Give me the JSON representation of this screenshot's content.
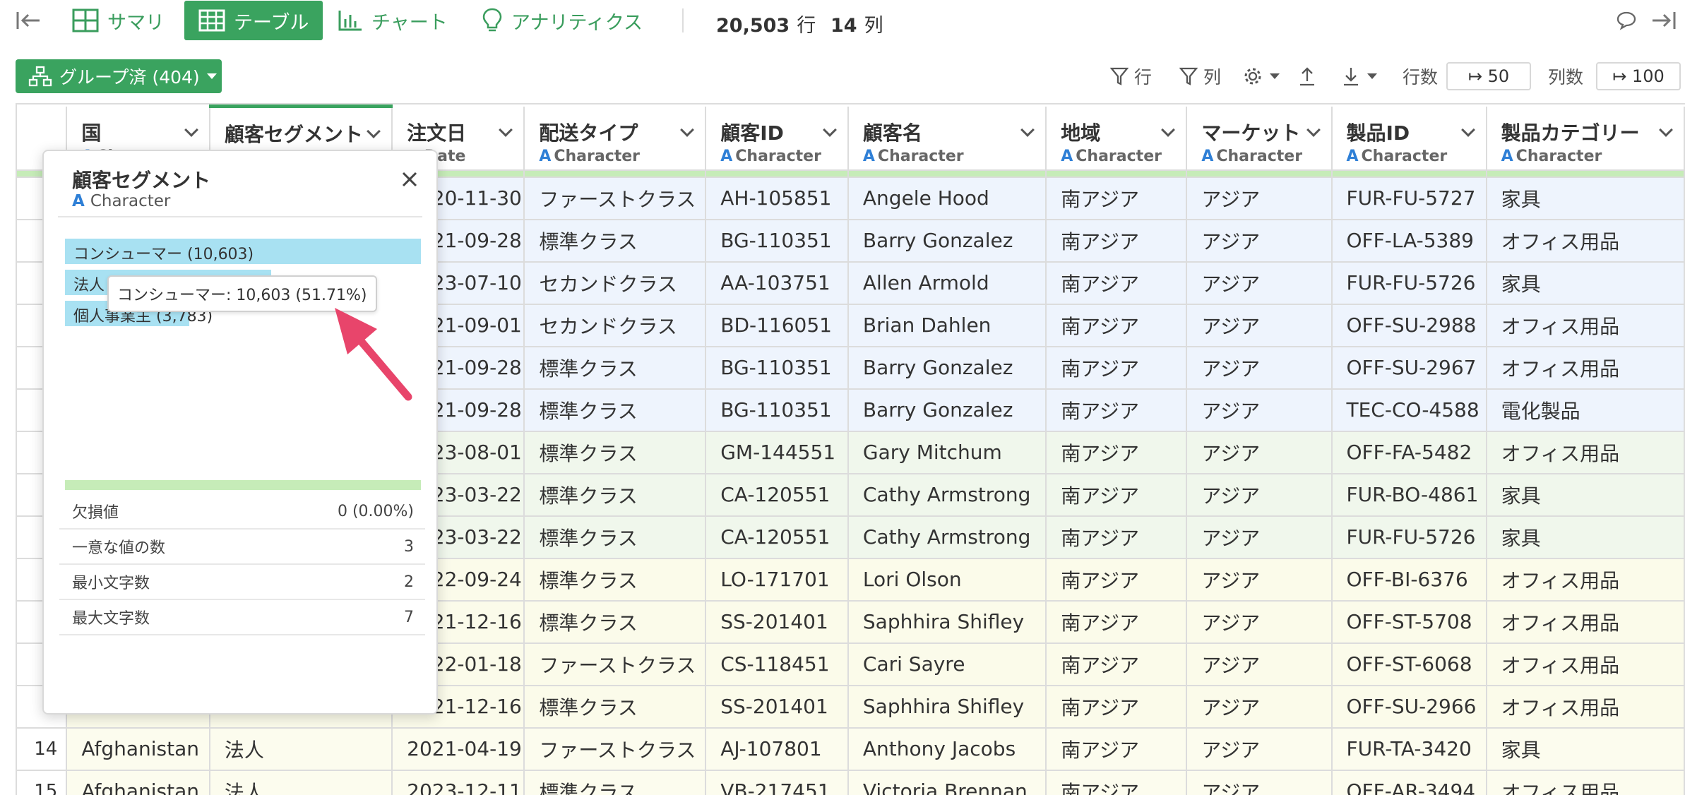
{
  "toolbar": {
    "tabs": [
      {
        "label": "サマリ",
        "icon": "summary-grid-icon"
      },
      {
        "label": "テーブル",
        "icon": "table-icon",
        "active": true
      },
      {
        "label": "チャート",
        "icon": "bar-chart-icon"
      },
      {
        "label": "アナリティクス",
        "icon": "lightbulb-icon"
      }
    ],
    "rows_count": "20,503",
    "rows_unit": "行",
    "cols_count": "14",
    "cols_unit": "列"
  },
  "subtoolbar": {
    "group_label": "グループ済 (404)",
    "row_filter_label": "行",
    "col_filter_label": "列",
    "rows_label": "行数",
    "rows_value": "↦ 50",
    "cols_label": "列数",
    "cols_value": "↦ 100"
  },
  "table": {
    "columns": [
      {
        "name": "国",
        "type": "Character"
      },
      {
        "name": "顧客セグメント",
        "type": "Character"
      },
      {
        "name": "注文日",
        "type": "Date"
      },
      {
        "name": "配送タイプ",
        "type": "Character"
      },
      {
        "name": "顧客ID",
        "type": "Character"
      },
      {
        "name": "顧客名",
        "type": "Character"
      },
      {
        "name": "地域",
        "type": "Character"
      },
      {
        "name": "マーケット",
        "type": "Character"
      },
      {
        "name": "製品ID",
        "type": "Character"
      },
      {
        "name": "製品カテゴリー",
        "type": "Character"
      }
    ],
    "rows": [
      {
        "n": "",
        "g": "g1",
        "c": [
          "",
          "",
          "2020-11-30",
          "ファーストクラス",
          "AH-105851",
          "Angele Hood",
          "南アジア",
          "アジア",
          "FUR-FU-5727",
          "家具"
        ]
      },
      {
        "n": "",
        "g": "g1",
        "c": [
          "",
          "",
          "2021-09-28",
          "標準クラス",
          "BG-110351",
          "Barry Gonzalez",
          "南アジア",
          "アジア",
          "OFF-LA-5389",
          "オフィス用品"
        ]
      },
      {
        "n": "",
        "g": "g1",
        "c": [
          "",
          "",
          "2023-07-10",
          "セカンドクラス",
          "AA-103751",
          "Allen Armold",
          "南アジア",
          "アジア",
          "FUR-FU-5726",
          "家具"
        ]
      },
      {
        "n": "",
        "g": "g1",
        "c": [
          "",
          "",
          "2021-09-01",
          "セカンドクラス",
          "BD-116051",
          "Brian Dahlen",
          "南アジア",
          "アジア",
          "OFF-SU-2988",
          "オフィス用品"
        ]
      },
      {
        "n": "",
        "g": "g1",
        "c": [
          "",
          "",
          "2021-09-28",
          "標準クラス",
          "BG-110351",
          "Barry Gonzalez",
          "南アジア",
          "アジア",
          "OFF-SU-2967",
          "オフィス用品"
        ]
      },
      {
        "n": "",
        "g": "g1",
        "c": [
          "",
          "",
          "2021-09-28",
          "標準クラス",
          "BG-110351",
          "Barry Gonzalez",
          "南アジア",
          "アジア",
          "TEC-CO-4588",
          "電化製品"
        ]
      },
      {
        "n": "",
        "g": "g2",
        "c": [
          "",
          "",
          "2023-08-01",
          "標準クラス",
          "GM-144551",
          "Gary Mitchum",
          "南アジア",
          "アジア",
          "OFF-FA-5482",
          "オフィス用品"
        ]
      },
      {
        "n": "",
        "g": "g2",
        "c": [
          "",
          "",
          "2023-03-22",
          "標準クラス",
          "CA-120551",
          "Cathy Armstrong",
          "南アジア",
          "アジア",
          "FUR-BO-4861",
          "家具"
        ]
      },
      {
        "n": "",
        "g": "g2",
        "c": [
          "",
          "",
          "2023-03-22",
          "標準クラス",
          "CA-120551",
          "Cathy Armstrong",
          "南アジア",
          "アジア",
          "FUR-FU-5726",
          "家具"
        ]
      },
      {
        "n": "1",
        "g": "g3",
        "c": [
          "",
          "",
          "2022-09-24",
          "標準クラス",
          "LO-171701",
          "Lori Olson",
          "南アジア",
          "アジア",
          "OFF-BI-6376",
          "オフィス用品"
        ]
      },
      {
        "n": "1",
        "g": "g3",
        "c": [
          "",
          "",
          "2021-12-16",
          "標準クラス",
          "SS-201401",
          "Saphhira Shifley",
          "南アジア",
          "アジア",
          "OFF-ST-5708",
          "オフィス用品"
        ]
      },
      {
        "n": "1",
        "g": "g3",
        "c": [
          "",
          "",
          "2022-01-18",
          "ファーストクラス",
          "CS-118451",
          "Cari Sayre",
          "南アジア",
          "アジア",
          "OFF-ST-6068",
          "オフィス用品"
        ]
      },
      {
        "n": "1",
        "g": "g3",
        "c": [
          "",
          "",
          "2021-12-16",
          "標準クラス",
          "SS-201401",
          "Saphhira Shifley",
          "南アジア",
          "アジア",
          "OFF-SU-2966",
          "オフィス用品"
        ]
      },
      {
        "n": "14",
        "g": "g4",
        "c": [
          "Afghanistan",
          "法人",
          "2021-04-19",
          "ファーストクラス",
          "AJ-107801",
          "Anthony Jacobs",
          "南アジア",
          "アジア",
          "FUR-TA-3420",
          "家具"
        ]
      },
      {
        "n": "15",
        "g": "g4",
        "c": [
          "Afghanistan",
          "法人",
          "2023-12-11",
          "標準クラス",
          "VB-217451",
          "Victoria Brennan",
          "南アジア",
          "アジア",
          "OFF-AR-3494",
          "オフィス用品"
        ]
      }
    ]
  },
  "popup": {
    "title": "顧客セグメント",
    "type": "Character",
    "bars": [
      {
        "label": "コンシューマー (10,603)",
        "share": 1.0
      },
      {
        "label": "法人",
        "share": 0.58
      },
      {
        "label": "個人事業主 (3,783)",
        "share": 0.35
      }
    ],
    "stats": [
      {
        "label": "欠損値",
        "value": "0 (0.00%)"
      },
      {
        "label": "一意な値の数",
        "value": "3"
      },
      {
        "label": "最小文字数",
        "value": "2"
      },
      {
        "label": "最大文字数",
        "value": "7"
      }
    ],
    "tooltip": "コンシューマー: 10,603 (51.71%)"
  },
  "colors": {
    "accent": "#3aa35f",
    "link": "#2e7fd6",
    "annotation_arrow": "#e8456b"
  }
}
